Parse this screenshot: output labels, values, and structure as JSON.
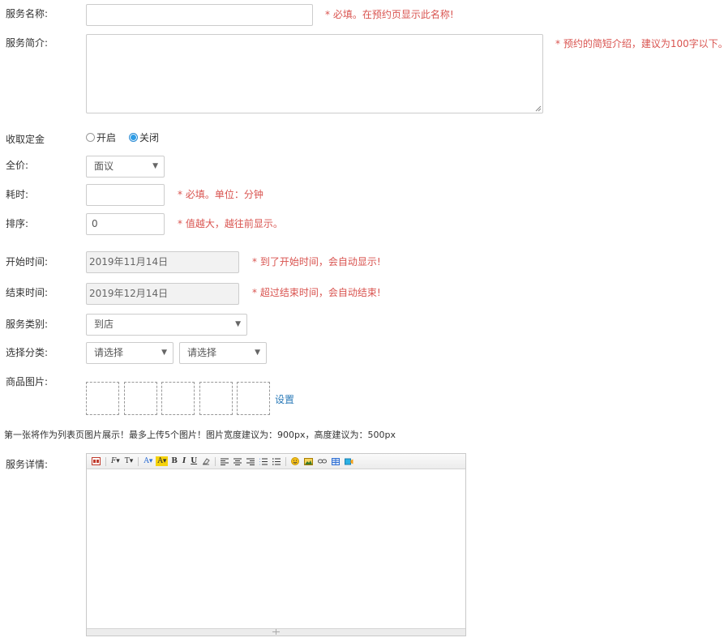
{
  "service_name": {
    "label": "服务名称:",
    "value": "",
    "hint": "* 必填。在预约页显示此名称!"
  },
  "service_intro": {
    "label": "服务简介:",
    "value": "",
    "hint": "* 预约的简短介绍，建议为100字以下。"
  },
  "deposit": {
    "label": "收取定金",
    "options": [
      "开启",
      "关闭"
    ],
    "selected": "关闭"
  },
  "price": {
    "label": "全价:",
    "selected": "面议"
  },
  "duration": {
    "label": "耗时:",
    "value": "",
    "hint": "* 必填。单位：分钟"
  },
  "sort": {
    "label": "排序:",
    "value": "0",
    "hint": "* 值越大，越往前显示。"
  },
  "start_time": {
    "label": "开始时间:",
    "value": "2019年11月14日",
    "hint": "* 到了开始时间，会自动显示!"
  },
  "end_time": {
    "label": "结束时间:",
    "value": "2019年12月14日",
    "hint": "* 超过结束时间，会自动结束!"
  },
  "service_type": {
    "label": "服务类别:",
    "selected": "到店"
  },
  "category": {
    "label": "选择分类:",
    "first": "请选择",
    "second": "请选择"
  },
  "product_images": {
    "label": "商品图片:",
    "slot_count": 5,
    "set_link": "设置",
    "note": "第一张将作为列表页图片展示！最多上传5个图片！图片宽度建议为：900px，高度建议为：500px"
  },
  "details": {
    "label": "服务详情:",
    "toolbar": [
      "source-icon",
      "font-family-icon",
      "font-size-icon",
      "font-color-icon",
      "highlight-icon",
      "bold-icon",
      "italic-icon",
      "underline-icon",
      "clear-format-icon",
      "align-left-icon",
      "align-center-icon",
      "align-right-icon",
      "ordered-list-icon",
      "unordered-list-icon",
      "emoticon-icon",
      "image-icon",
      "link-icon",
      "table-icon",
      "video-icon"
    ],
    "toolbar_glyphs": {
      "font_family": "F",
      "font_size": "T",
      "font_color": "A",
      "highlight": "A",
      "bold": "B",
      "italic": "I",
      "underline": "U"
    }
  },
  "colors": {
    "hint": "#d9534f",
    "link": "#2a7ab8",
    "radio_checked": "#2f9de6"
  }
}
